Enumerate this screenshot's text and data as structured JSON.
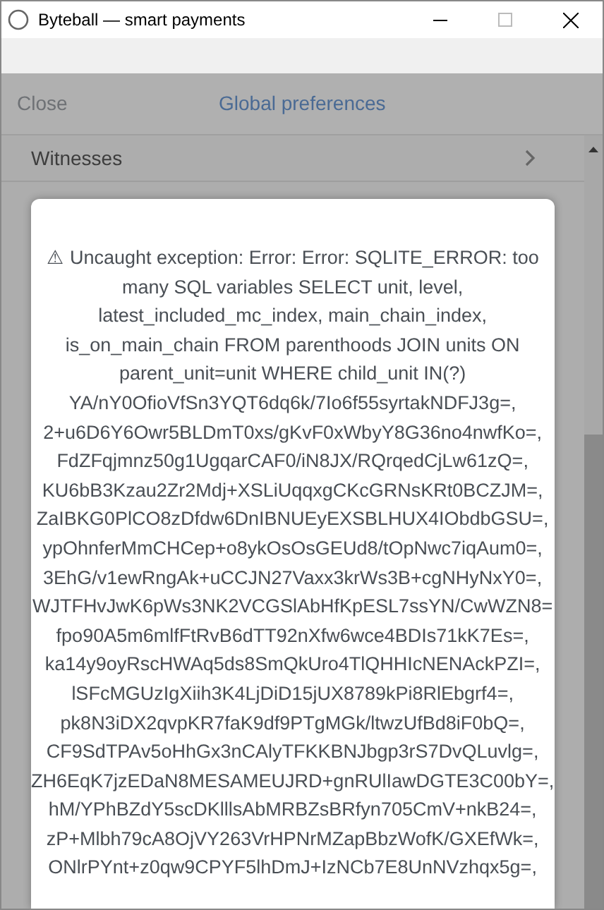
{
  "window": {
    "title": "Byteball — smart payments"
  },
  "header": {
    "close": "Close",
    "title": "Global preferences"
  },
  "list": [
    {
      "label": "Witnesses"
    }
  ],
  "dialog": {
    "message_lines": [
      "⚠ Uncaught exception: Error: Error: SQLITE_ERROR: too",
      "many SQL variables SELECT unit, level,",
      "latest_included_mc_index, main_chain_index,",
      "is_on_main_chain FROM parenthoods JOIN units ON",
      "parent_unit=unit WHERE child_unit IN(?)",
      "YA/nY0OfioVfSn3YQT6dq6k/7Io6f55syrtakNDFJ3g=,",
      "2+u6D6Y6Owr5BLDmT0xs/gKvF0xWbyY8G36no4nwfKo=,",
      "FdZFqjmnz50g1UgqarCAF0/iN8JX/RQrqedCjLw61zQ=,",
      "KU6bB3Kzau2Zr2Mdj+XSLiUqqxgCKcGRNsKRt0BCZJM=,",
      "ZaIBKG0PlCO8zDfdw6DnIBNUEyEXSBLHUX4IObdbGSU=,",
      "ypOhnferMmCHCep+o8ykOsOsGEUd8/tOpNwc7iqAum0=,",
      "3EhG/v1ewRngAk+uCCJN27Vaxx3krWs3B+cgNHyNxY0=,",
      "WJTFHvJwK6pWs3NK2VCGSlAbHfKpESL7ssYN/CwWZN8=",
      "fpo90A5m6mlfFtRvB6dTT92nXfw6wce4BDIs71kK7Es=,",
      "ka14y9oyRscHWAq5ds8SmQkUro4TlQHHIcNENAckPZI=,",
      "lSFcMGUzIgXiih3K4LjDiD15jUX8789kPi8RlEbgrf4=,",
      "pk8N3iDX2qvpKR7faK9df9PTgMGk/ltwzUfBd8iF0bQ=,",
      "CF9SdTPAv5oHhGx3nCAlyTFKKBNJbgp3rS7DvQLuvlg=,",
      "ZH6EqK7jzEDaN8MESAMEUJRD+gnRUlIawDGTE3C00bY=,",
      "hM/YPhBZdY5scDKlllsAbMRBZsBRfyn705CmV+nkB24=,",
      "zP+Mlbh79cA8OjVY263VrHPNrMZapBbzWofK/GXEfWk=,",
      "ONlrPYnt+z0qw9CPYF5lhDmJ+IzNCb7E8UnNVzhqx5g=,"
    ]
  }
}
